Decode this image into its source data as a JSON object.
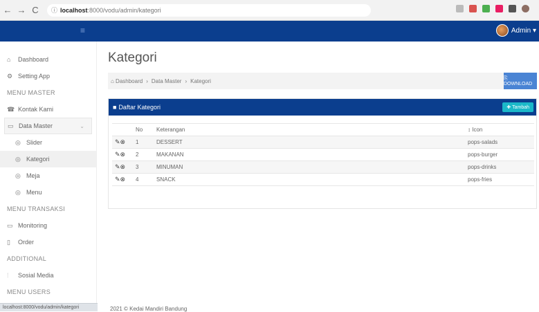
{
  "browser": {
    "back": "←",
    "forward": "→",
    "reload": "C",
    "url_host": "localhost",
    "url_path": ":8000/vodu/admin/kategori",
    "info": "ⓘ",
    "status_url": "localhost:8000/vodu/admin/kategori"
  },
  "topbar": {
    "toggle": "≡",
    "user": "Admin ▾"
  },
  "sidebar": {
    "items": [
      {
        "icon": "⌂",
        "label": "Dashboard"
      },
      {
        "icon": "⚙",
        "label": "Setting App"
      }
    ],
    "header_master": "MENU MASTER",
    "master_items": [
      {
        "icon": "☎",
        "label": "Kontak Kami"
      }
    ],
    "data_master": {
      "icon": "▭",
      "label": "Data Master",
      "chevron": "⌄"
    },
    "sub_items": [
      {
        "icon": "◎",
        "label": "Slider"
      },
      {
        "icon": "◎",
        "label": "Kategori"
      },
      {
        "icon": "◎",
        "label": "Meja"
      },
      {
        "icon": "◎",
        "label": "Menu"
      }
    ],
    "header_transaksi": "MENU TRANSAKSI",
    "transaksi_items": [
      {
        "icon": "▭",
        "label": "Monitoring"
      },
      {
        "icon": "▯",
        "label": "Order"
      }
    ],
    "header_additional": "ADDITIONAL",
    "additional_items": [
      {
        "icon": "⫶",
        "label": "Sosial Media"
      }
    ],
    "header_users": "MENU USERS"
  },
  "main": {
    "title": "Kategori",
    "breadcrumb": [
      "⌂ Dashboard",
      "›",
      "Data Master",
      "›",
      "Kategori"
    ],
    "download_label": "⎘ DOWNLOAD",
    "panel_title": "Daftar Kategori",
    "add_label": "✚ Tambah",
    "table": {
      "headers": [
        "",
        "No",
        "Keterangan",
        "↕ Icon"
      ],
      "rows": [
        {
          "no": "1",
          "ket": "DESSERT",
          "icon": "pops-salads"
        },
        {
          "no": "2",
          "ket": "MAKANAN",
          "icon": "pops-burger"
        },
        {
          "no": "3",
          "ket": "MINUMAN",
          "icon": "pops-drinks"
        },
        {
          "no": "4",
          "ket": "SNACK",
          "icon": "pops-fries"
        }
      ],
      "action_glyphs": "✎⊗"
    },
    "footer": "2021 © Kedai Mandiri Bandung"
  },
  "colors": {
    "brand": "#0b3e8e",
    "download": "#4a84d4",
    "add": "#1bb8c9"
  }
}
